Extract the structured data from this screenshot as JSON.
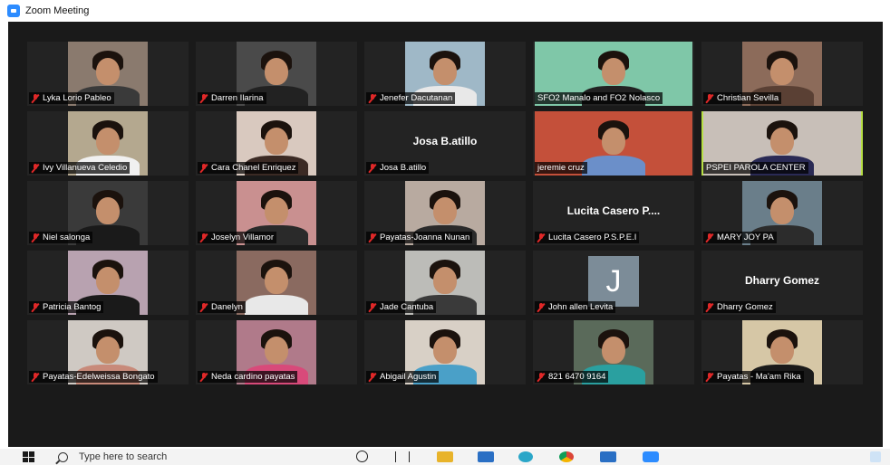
{
  "window": {
    "title": "Zoom Meeting"
  },
  "participants": [
    {
      "name": "Lyka Lorio Pableo",
      "video": true,
      "bg": "#8a7a6e",
      "shirt": "#3a3a3a"
    },
    {
      "name": "Darren Ilarina",
      "video": true,
      "bg": "#4a4a4a",
      "shirt": "#222222"
    },
    {
      "name": "Jenefer Dacutanan",
      "video": true,
      "bg": "#9fb8c7",
      "shirt": "#e8e8e8"
    },
    {
      "name": "SFO2 Manalo and FO2 Nolasco",
      "video": true,
      "bg": "#7fc7a8",
      "shirt": "#222222"
    },
    {
      "name": "Christian Sevilla",
      "video": true,
      "bg": "#8c6b5a",
      "shirt": "#5a4034"
    },
    {
      "name": "Ivy Villanueva Celedio",
      "video": true,
      "bg": "#b4a88f",
      "shirt": "#f0f0f0"
    },
    {
      "name": "Cara Chanel Enriquez",
      "video": true,
      "bg": "#d9c9bf",
      "shirt": "#3b2a24"
    },
    {
      "name": "Josa B.atillo",
      "video": false,
      "display": "Josa B.atillo"
    },
    {
      "name": "jeremie cruz",
      "video": true,
      "bg": "#c4503a",
      "shirt": "#6b8fc9"
    },
    {
      "name": "PSPEI PAROLA CENTER",
      "video": true,
      "bg": "#c8bfb8",
      "shirt": "#2a2a55",
      "active": true
    },
    {
      "name": "Niel salonga",
      "video": true,
      "bg": "#3a3a3a",
      "shirt": "#1a1a1a"
    },
    {
      "name": "Joselyn Villamor",
      "video": true,
      "bg": "#c99090",
      "shirt": "#2a2a2a"
    },
    {
      "name": "Payatas-Joanna Nunan",
      "video": true,
      "bg": "#b8aaa0",
      "shirt": "#2a2a2a"
    },
    {
      "name": "Lucita Casero P.S.P.E.I",
      "video": false,
      "display": "Lucita Casero P...."
    },
    {
      "name": "MARY JOY PA",
      "video": true,
      "bg": "#6a7e8a",
      "shirt": "#2c2c2c"
    },
    {
      "name": "Patricia Bantog",
      "video": true,
      "bg": "#b8a2b0",
      "shirt": "#1a1a1a"
    },
    {
      "name": "Danelyn",
      "video": true,
      "bg": "#8a6a60",
      "shirt": "#e8e8e8"
    },
    {
      "name": "Jade Cantuba",
      "video": true,
      "bg": "#bcbcb8",
      "shirt": "#3a3a3a"
    },
    {
      "name": "John allen Levita",
      "video": false,
      "avatar": "J"
    },
    {
      "name": "Dharry Gomez",
      "video": false,
      "display": "Dharry Gomez"
    },
    {
      "name": "Payatas-Edelweissa Bongato",
      "video": true,
      "bg": "#cfc9c3",
      "shirt": "#c88a7a"
    },
    {
      "name": "Neda cardino payatas",
      "video": true,
      "bg": "#b07a8a",
      "shirt": "#d84a7a"
    },
    {
      "name": "Abigail Agustin",
      "video": true,
      "bg": "#d8d0c6",
      "shirt": "#4aa0c8"
    },
    {
      "name": "821 6470 9164",
      "video": true,
      "bg": "#5a6a5a",
      "shirt": "#2aa0a0"
    },
    {
      "name": "Payatas - Ma'am Rika",
      "video": true,
      "bg": "#d6c7a6",
      "shirt": "#1a1a1a"
    }
  ],
  "taskbar": {
    "search_placeholder": "Type here to search"
  },
  "colors": {
    "meeting_bg": "#1a1a1a",
    "tile_bg": "#232323",
    "active_speaker": "#b7e045",
    "muted_mic": "#e02828",
    "zoom_blue": "#2d8cff"
  }
}
